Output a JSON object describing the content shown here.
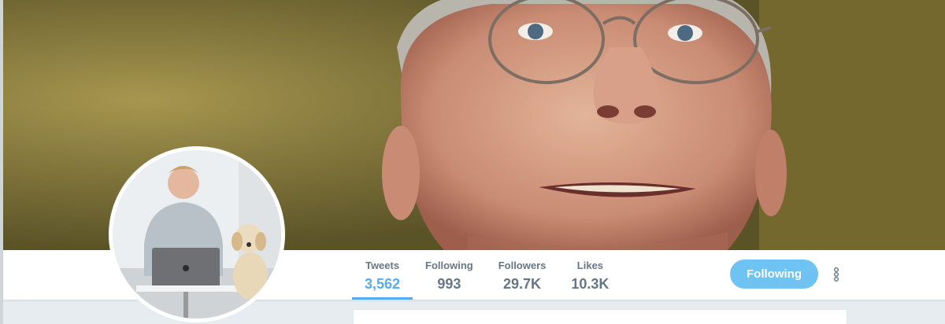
{
  "profile_nav": {
    "stats": [
      {
        "label": "Tweets",
        "value": "3,562",
        "active": true
      },
      {
        "label": "Following",
        "value": "993",
        "active": false
      },
      {
        "label": "Followers",
        "value": "29.7K",
        "active": false
      },
      {
        "label": "Likes",
        "value": "10.3K",
        "active": false
      }
    ],
    "follow_button_label": "Following",
    "more_icon": "vertical-ellipsis-icon"
  },
  "colors": {
    "accent": "#55acee",
    "follow_button": "#6ec3f2",
    "stat_text": "#657786",
    "page_background": "#e6ecf0"
  }
}
